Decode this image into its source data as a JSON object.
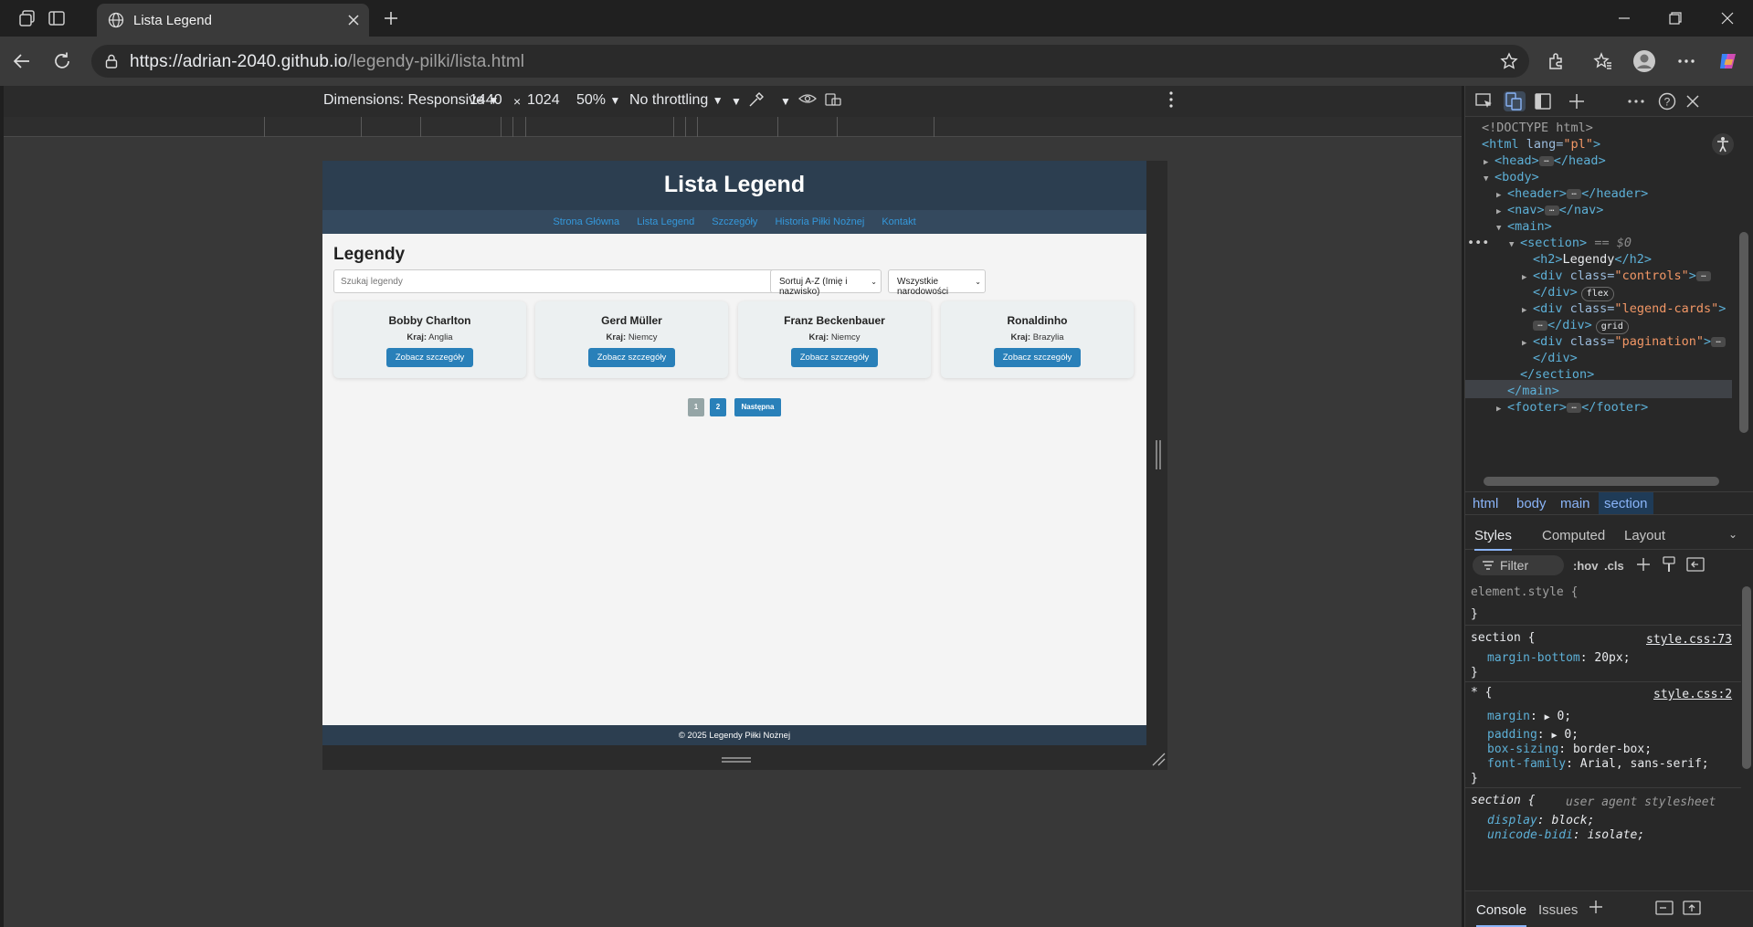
{
  "browser": {
    "tab_title": "Lista Legend",
    "url_host": "https://adrian-2040.github.io",
    "url_path": "/legendy-pilki/lista.html"
  },
  "device_toolbar": {
    "dimensions_label": "Dimensions: Responsive",
    "width": "1440",
    "times": "×",
    "height": "1024",
    "zoom": "50%",
    "throttling": "No throttling"
  },
  "site": {
    "title": "Lista Legend",
    "nav": [
      "Strona Główna",
      "Lista Legend",
      "Szczegóły",
      "Historia Piłki Nożnej",
      "Kontakt"
    ],
    "section_heading": "Legendy",
    "search_placeholder": "Szukaj legendy",
    "sort_select": "Sortuj A-Z (Imię i nazwisko)",
    "nationality_select": "Wszystkie narodowości",
    "country_label": "Kraj:",
    "details_button": "Zobacz szczegóły",
    "cards": [
      {
        "name": "Bobby Charlton",
        "country": "Anglia"
      },
      {
        "name": "Gerd Müller",
        "country": "Niemcy"
      },
      {
        "name": "Franz Beckenbauer",
        "country": "Niemcy"
      },
      {
        "name": "Ronaldinho",
        "country": "Brazylia"
      }
    ],
    "pagination": [
      "1",
      "2",
      "Następna"
    ],
    "footer": "© 2025 Legendy Piłki Nożnej"
  },
  "devtools": {
    "dom": {
      "doctype": "<!DOCTYPE html>",
      "html_open": "<html lang=\"pl\">",
      "lines": {
        "head": "head",
        "body": "body",
        "header": "header",
        "nav": "nav",
        "main": "main",
        "section": "section",
        "section_ref": "== $0",
        "h2_text": "Legendy",
        "controls": "controls",
        "legend_cards": "legend-cards",
        "pagination": "pagination",
        "footer": "footer"
      },
      "badge_flex": "flex",
      "badge_grid": "grid"
    },
    "breadcrumbs": [
      "html",
      "body",
      "main",
      "section"
    ],
    "style_tabs": [
      "Styles",
      "Computed",
      "Layout"
    ],
    "filter_placeholder": "Filter",
    "hov": ":hov",
    "cls": ".cls",
    "rules": {
      "element_style": "element.style {",
      "close": "}",
      "r1_selector": "section {",
      "r1_source": "style.css:73",
      "r1_prop": "margin-bottom",
      "r1_val": "20px;",
      "r2_selector": "* {",
      "r2_source": "style.css:2",
      "r2_p1": "margin",
      "r2_v1": "0;",
      "r2_p2": "padding",
      "r2_v2": "0;",
      "r2_p3": "box-sizing",
      "r2_v3": "border-box;",
      "r2_p4": "font-family",
      "r2_v4": "Arial, sans-serif;",
      "r3_selector": "section {",
      "r3_source": "user agent stylesheet",
      "r3_p1": "display",
      "r3_v1": "block;",
      "r3_p2": "unicode-bidi",
      "r3_v2": "isolate;"
    },
    "drawer_tabs": [
      "Console",
      "Issues"
    ]
  },
  "colors": {
    "header_bg": "#2c3e50",
    "nav_link": "#3498db",
    "button_bg": "#2980b9",
    "card_bg": "#ecf0f1"
  }
}
